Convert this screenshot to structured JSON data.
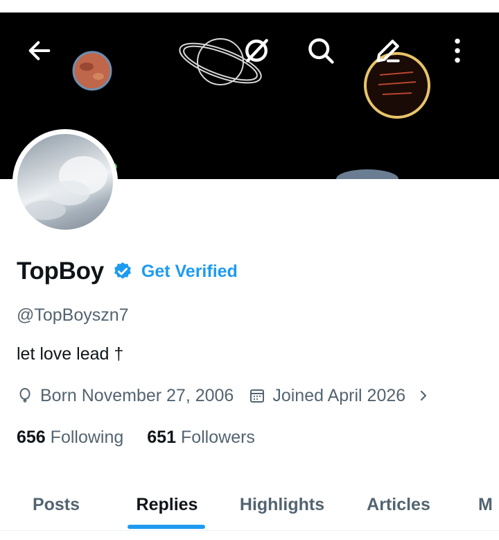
{
  "header": {
    "icons": [
      "back-arrow-icon",
      "grok-icon",
      "search-icon",
      "edit-icon",
      "more-vertical-icon"
    ]
  },
  "profile": {
    "name": "TopBoy",
    "verified_cta": "Get Verified",
    "handle": "@TopBoyszn7",
    "bio": "let love lead †",
    "birthday": "Born November 27, 2006",
    "joined": "Joined April 2026",
    "following_count": "656",
    "following_label": "Following",
    "followers_count": "651",
    "followers_label": "Followers"
  },
  "tabs": [
    {
      "label": "Posts",
      "active": false
    },
    {
      "label": "Replies",
      "active": true
    },
    {
      "label": "Highlights",
      "active": false
    },
    {
      "label": "Articles",
      "active": false
    },
    {
      "label": "M",
      "active": false
    }
  ],
  "colors": {
    "accent": "#1d9bf0",
    "text_primary": "#0f1419",
    "text_secondary": "#536471",
    "banner_bg": "#000000"
  }
}
